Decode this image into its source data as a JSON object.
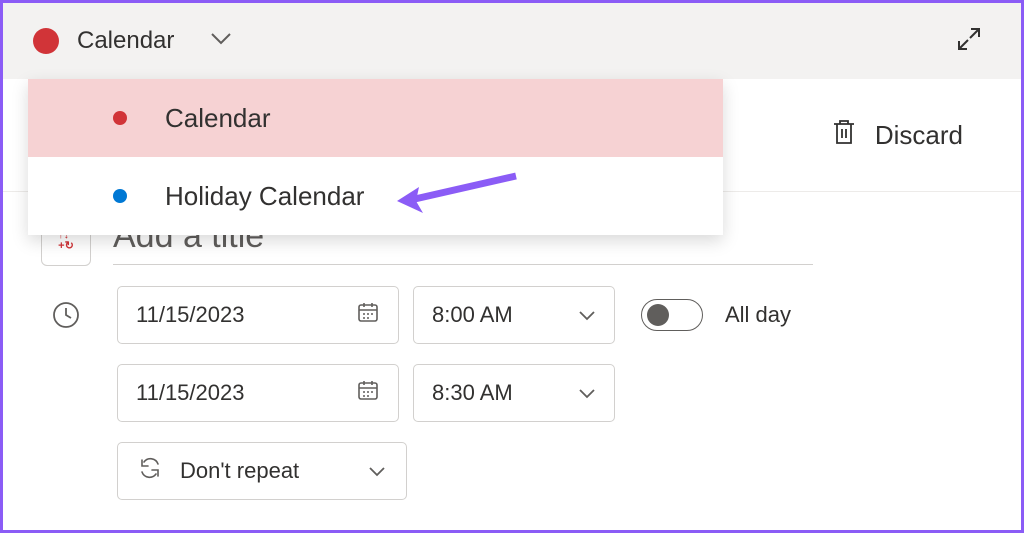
{
  "header": {
    "calendar_label": "Calendar"
  },
  "dropdown": {
    "items": [
      {
        "label": "Calendar",
        "color": "red",
        "selected": true
      },
      {
        "label": "Holiday Calendar",
        "color": "blue",
        "selected": false
      }
    ]
  },
  "actions": {
    "discard_label": "Discard"
  },
  "event": {
    "title_placeholder": "Add a title",
    "start_date": "11/15/2023",
    "start_time": "8:00 AM",
    "end_date": "11/15/2023",
    "end_time": "8:30 AM",
    "all_day_label": "All day",
    "all_day": false,
    "repeat_label": "Don't repeat"
  }
}
